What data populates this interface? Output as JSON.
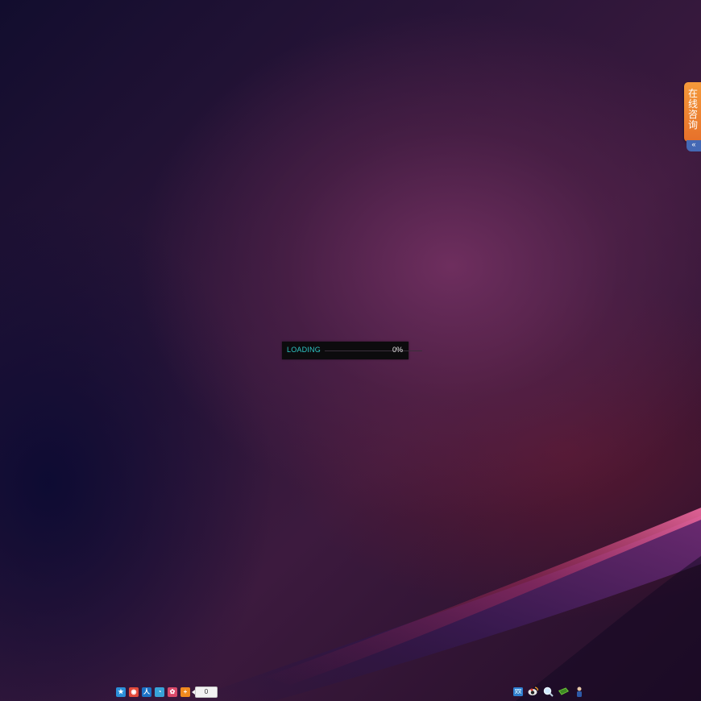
{
  "loader": {
    "label": "LOADING",
    "percent_text": "0%",
    "progress": 0
  },
  "consult_tab": {
    "label": "在线咨询",
    "toggle_glyph": "«"
  },
  "share_bar": {
    "icons": [
      {
        "name": "qzone-star-icon",
        "glyph": "★",
        "color": "#2b8fd8"
      },
      {
        "name": "weibo-icon",
        "glyph": "◉",
        "color": "#e24a3b"
      },
      {
        "name": "renren-icon",
        "glyph": "人",
        "color": "#1b72c6"
      },
      {
        "name": "tencent-weibo-icon",
        "glyph": "◔",
        "color": "#38a3d8"
      },
      {
        "name": "kaixin-icon",
        "glyph": "✿",
        "color": "#d94a6a"
      },
      {
        "name": "more-share-icon",
        "glyph": "+",
        "color": "#f08a1e"
      }
    ],
    "count": "0"
  },
  "tray": {
    "icons": [
      {
        "name": "qq-icon"
      },
      {
        "name": "weibo-tray-icon"
      },
      {
        "name": "search-icon"
      },
      {
        "name": "money-icon"
      },
      {
        "name": "person-icon"
      }
    ]
  },
  "colors": {
    "accent": "#2fc7c7",
    "consult_orange": "#f08a30",
    "toggle_blue": "#4468b4"
  }
}
